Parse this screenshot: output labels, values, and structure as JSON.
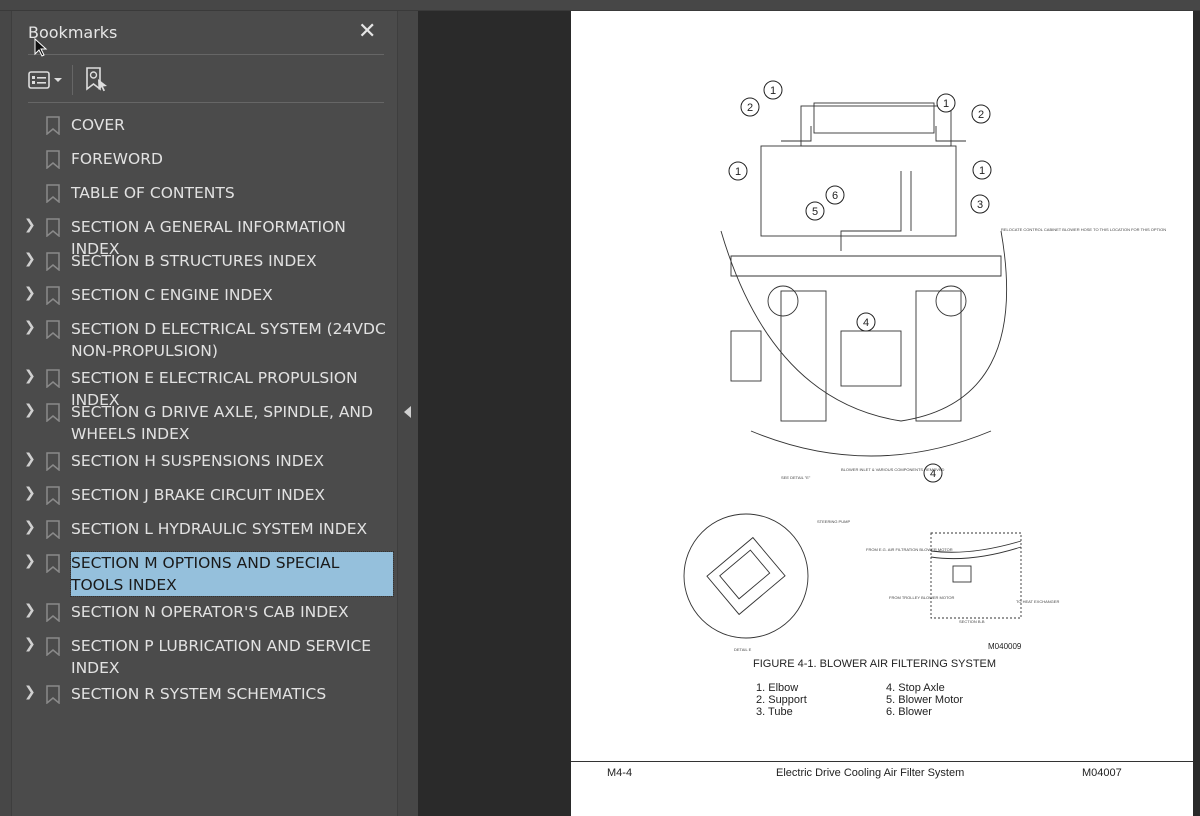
{
  "panel": {
    "title": "Bookmarks",
    "close_icon": "close-icon",
    "options_icon": "list-options-icon",
    "find_bookmark_icon": "find-current-bookmark-icon"
  },
  "bookmarks": [
    {
      "label": "COVER",
      "expandable": false
    },
    {
      "label": "FOREWORD",
      "expandable": false
    },
    {
      "label": "TABLE OF CONTENTS",
      "expandable": false
    },
    {
      "label": "SECTION A GENERAL INFORMATION INDEX",
      "expandable": true
    },
    {
      "label": "SECTION B STRUCTURES INDEX",
      "expandable": true
    },
    {
      "label": "SECTION C ENGINE INDEX",
      "expandable": true
    },
    {
      "label": "SECTION D  ELECTRICAL SYSTEM (24VDC NON-PROPULSION)",
      "expandable": true
    },
    {
      "label": "SECTION E ELECTRICAL PROPULSION INDEX",
      "expandable": true
    },
    {
      "label": "SECTION G DRIVE AXLE, SPINDLE, AND WHEELS INDEX",
      "expandable": true
    },
    {
      "label": "SECTION H SUSPENSIONS INDEX",
      "expandable": true
    },
    {
      "label": "SECTION J BRAKE CIRCUIT INDEX",
      "expandable": true
    },
    {
      "label": "SECTION L HYDRAULIC SYSTEM INDEX",
      "expandable": true
    },
    {
      "label": "SECTION M OPTIONS AND SPECIAL TOOLS INDEX",
      "expandable": true,
      "selected": true
    },
    {
      "label": "SECTION N OPERATOR'S CAB INDEX",
      "expandable": true
    },
    {
      "label": "SECTION P LUBRICATION AND SERVICE INDEX",
      "expandable": true
    },
    {
      "label": "SECTION R  SYSTEM SCHEMATICS",
      "expandable": true
    }
  ],
  "document": {
    "drawing_notes": {
      "relocate": "RELOCATE CONTROL CABINET BLOWER HOSE TO THIS LOCATION FOR THIS OPTION",
      "see_detail": "SEE DETAIL \"E\"",
      "removed": "BLOWER INLET & VARIOUS COMPONENTS REMOVED",
      "steering_pump": "STEERING PUMP",
      "detail_e": "DETAIL E",
      "from_eg": "FROM E.G. AIR FILTRATION BLOWER MOTOR",
      "from_trolley": "FROM TROLLEY BLOWER MOTOR",
      "to_heat": "TO HEAT EXCHANGER",
      "section_bb": "SECTION B-B"
    },
    "drawing_number": "M040009",
    "figure_caption": "FIGURE 4-1. BLOWER AIR FILTERING SYSTEM",
    "legend_col1": [
      "1. Elbow",
      "2. Support",
      "3. Tube"
    ],
    "legend_col2": [
      "4. Stop Axle",
      "5. Blower Motor",
      "6. Blower"
    ],
    "footer": {
      "left": "M4-4",
      "center": "Electric Drive Cooling Air Filter System",
      "right": "M04007"
    }
  },
  "colors": {
    "selection": "#95c0dc",
    "panel": "#4b4b4b",
    "canvas": "#2a2a2a"
  }
}
